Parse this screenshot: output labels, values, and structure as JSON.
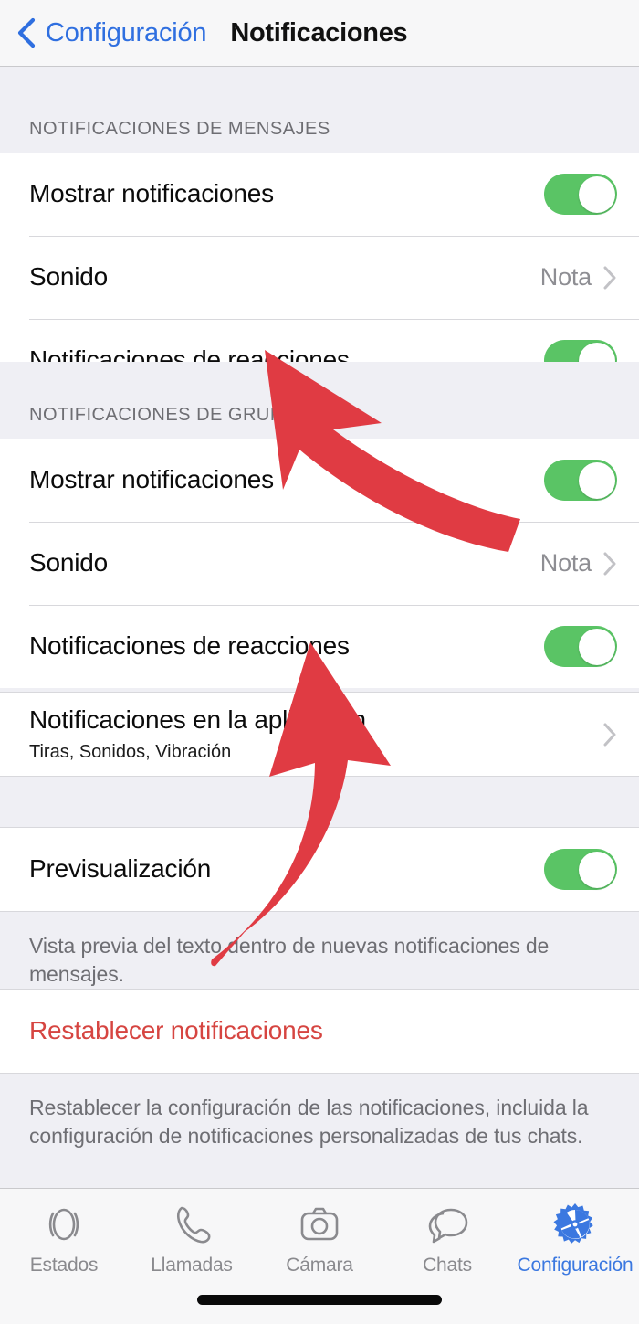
{
  "nav": {
    "back_label": "Configuración",
    "title": "Notificaciones",
    "back_icon": "chevron-left-icon",
    "accent_blue": "#2f6fe0"
  },
  "sections": [
    {
      "header": "NOTIFICACIONES DE MENSAJES",
      "rows": [
        {
          "title": "Mostrar notificaciones",
          "control": "toggle",
          "toggle_on": true
        },
        {
          "title": "Sonido",
          "control": "disclosure",
          "value": "Nota"
        },
        {
          "title": "Notificaciones de reacciones",
          "control": "toggle",
          "toggle_on": true
        }
      ]
    },
    {
      "header": "NOTIFICACIONES DE GRUPOS",
      "rows": [
        {
          "title": "Mostrar notificaciones",
          "control": "toggle",
          "toggle_on": true
        },
        {
          "title": "Sonido",
          "control": "disclosure",
          "value": "Nota"
        },
        {
          "title": "Notificaciones de reacciones",
          "control": "toggle",
          "toggle_on": true
        }
      ]
    },
    {
      "header": "",
      "rows": [
        {
          "title": "Notificaciones en la aplicación",
          "subtitle": "Tiras, Sonidos, Vibración",
          "control": "disclosure",
          "value": ""
        }
      ]
    },
    {
      "header": "",
      "rows": [
        {
          "title": "Previsualización",
          "control": "toggle",
          "toggle_on": true
        }
      ],
      "footer": "Vista previa del texto dentro de nuevas notificaciones de mensajes."
    },
    {
      "header": "",
      "rows": [
        {
          "title": "Restablecer notificaciones",
          "control": "none",
          "destructive": true
        }
      ],
      "footer": "Restablecer la configuración de las notificaciones, incluida la configuración de notificaciones personalizadas de tus chats."
    }
  ],
  "colors": {
    "toggle_on": "#5ac465",
    "destructive_red": "#d64541",
    "annotation_red": "#e03b43",
    "value_gray": "#8e8e93",
    "group_bg": "#efeff4"
  },
  "annotations": [
    {
      "name": "arrow-to-reactions-row",
      "direction": "up-left",
      "color": "#e03b43"
    },
    {
      "name": "arrow-to-in-app-notifications-row",
      "direction": "up",
      "color": "#e03b43"
    }
  ],
  "tabbar": {
    "items": [
      {
        "label": "Estados",
        "icon": "status-rings-icon",
        "active": false
      },
      {
        "label": "Llamadas",
        "icon": "phone-icon",
        "active": false
      },
      {
        "label": "Cámara",
        "icon": "camera-icon",
        "active": false
      },
      {
        "label": "Chats",
        "icon": "chat-bubbles-icon",
        "active": false
      },
      {
        "label": "Configuración",
        "icon": "gear-icon",
        "active": true
      }
    ]
  }
}
